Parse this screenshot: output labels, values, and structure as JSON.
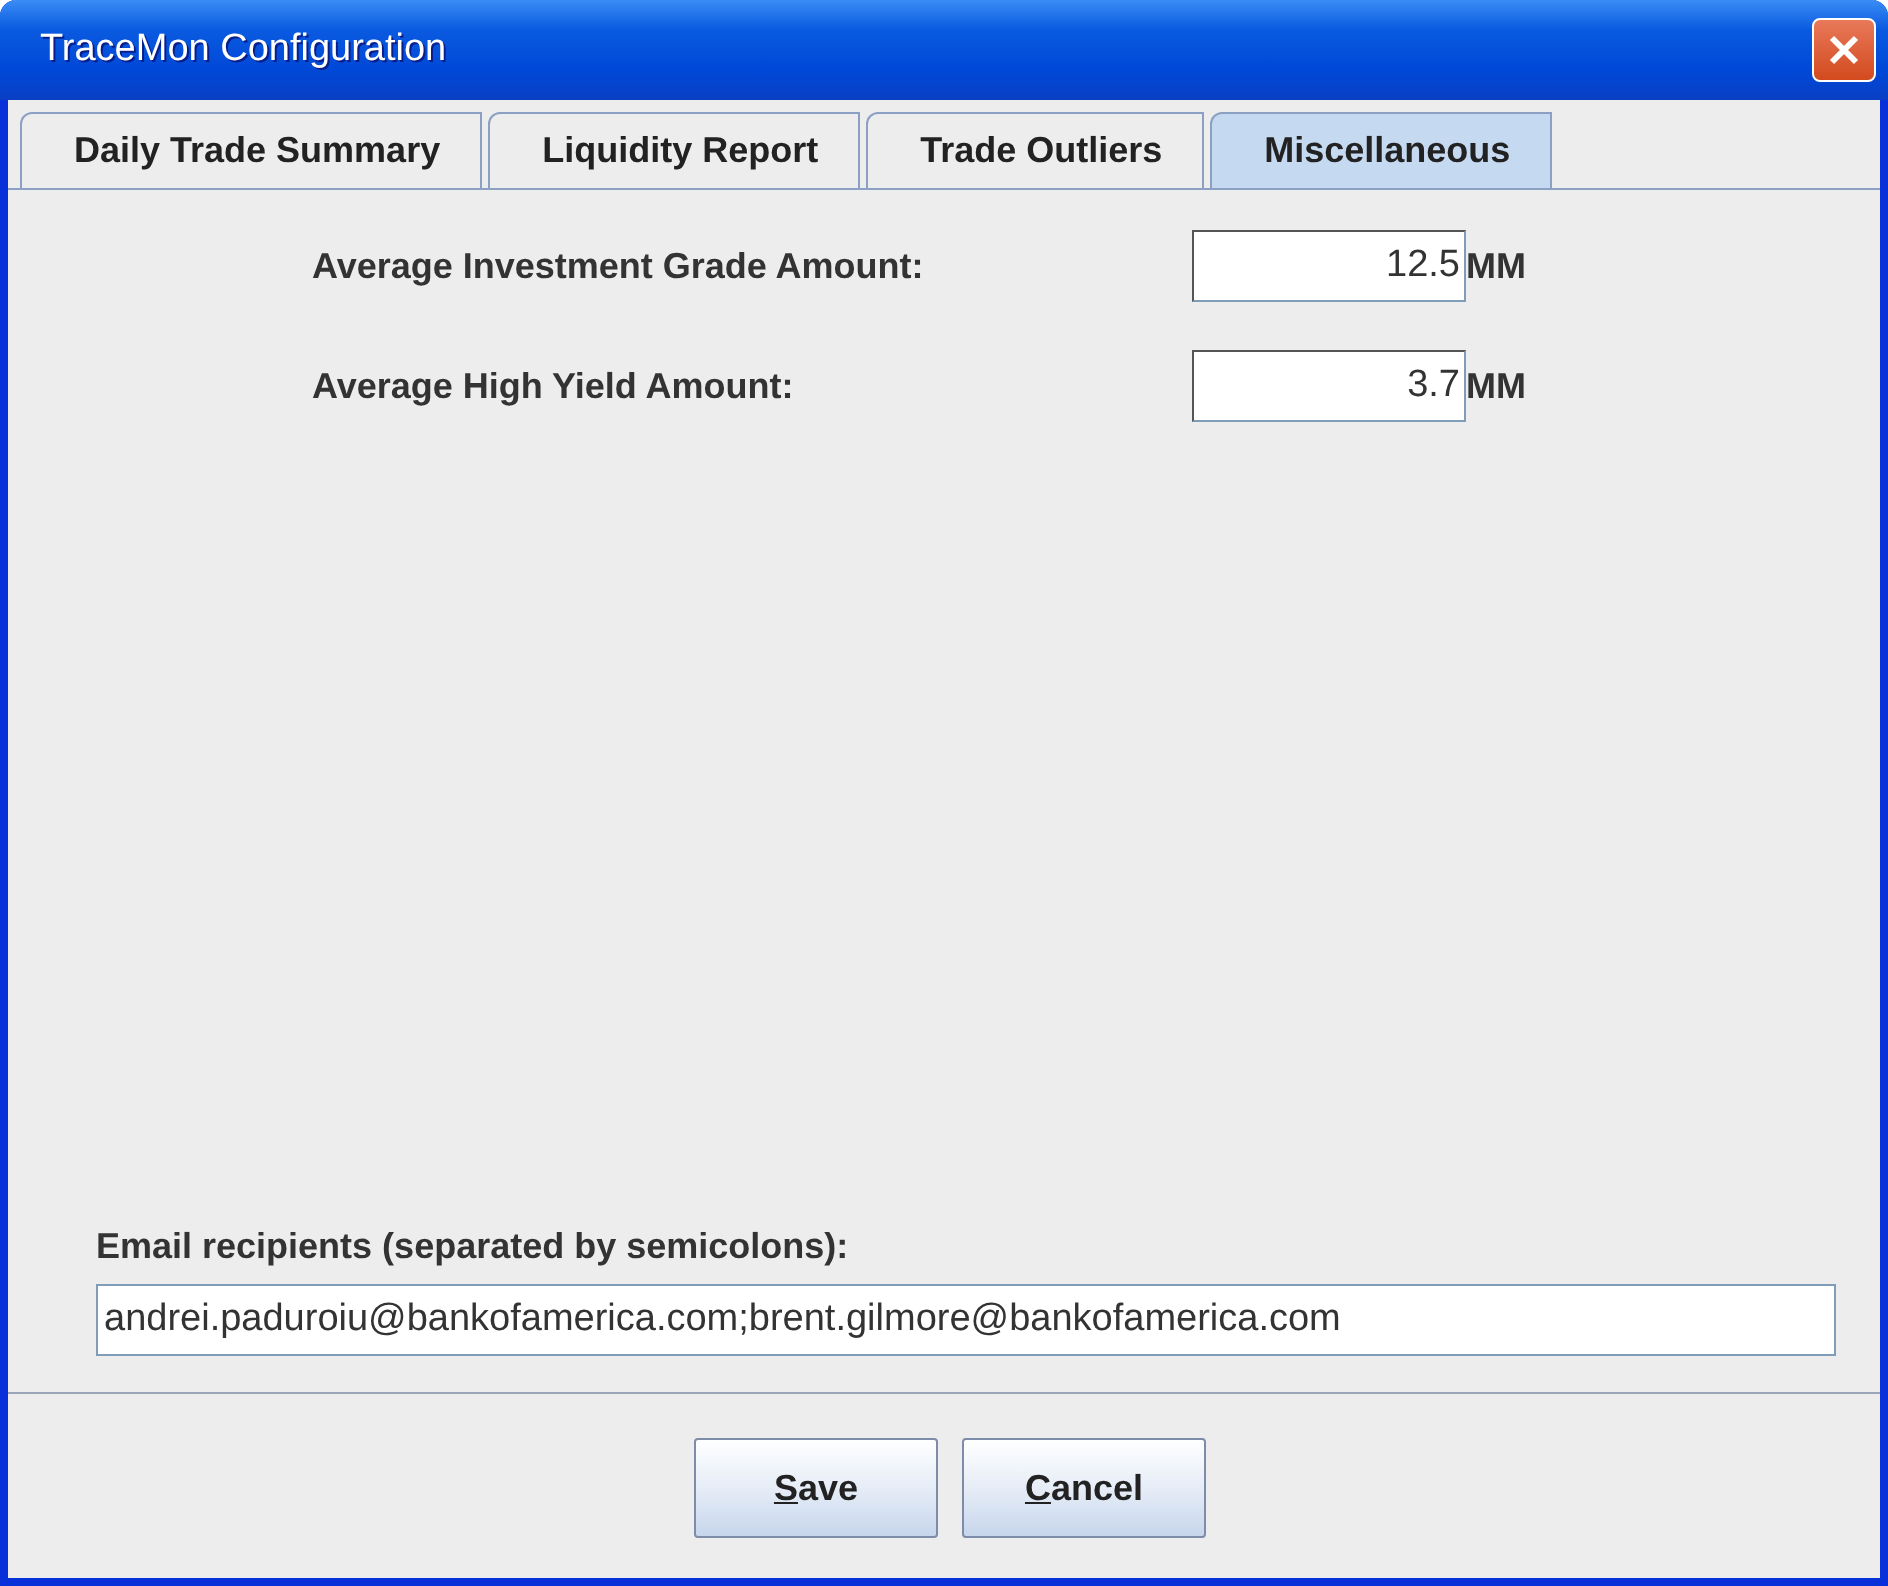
{
  "window": {
    "title": "TraceMon Configuration"
  },
  "tabs": [
    {
      "label": "Daily Trade Summary",
      "selected": false
    },
    {
      "label": "Liquidity Report",
      "selected": false
    },
    {
      "label": "Trade Outliers",
      "selected": false
    },
    {
      "label": "Miscellaneous",
      "selected": true
    }
  ],
  "amounts": [
    {
      "label": "Average Investment Grade Amount:",
      "value": "12.5",
      "unit": "MM"
    },
    {
      "label": "Average High Yield Amount:",
      "value": "3.7",
      "unit": "MM"
    }
  ],
  "email": {
    "label": "Email recipients (separated by semicolons):",
    "value": "andrei.paduroiu@bankofamerica.com;brent.gilmore@bankofamerica.com"
  },
  "buttons": [
    {
      "label": "Save",
      "mnemonic_first_letter": true
    },
    {
      "label": "Cancel",
      "mnemonic_first_letter": true
    }
  ]
}
